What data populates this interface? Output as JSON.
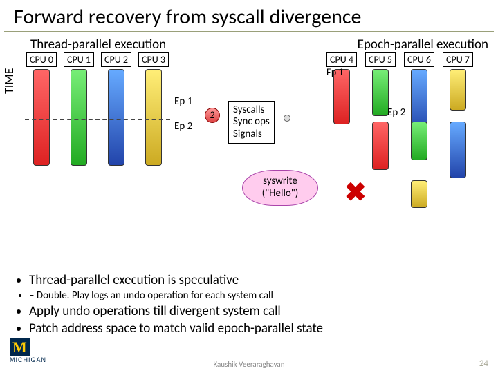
{
  "title": "Forward recovery from syscall divergence",
  "sections": {
    "left": "Thread-parallel execution",
    "right": "Epoch-parallel execution"
  },
  "time_axis": "TIME",
  "cpus": [
    "CPU 0",
    "CPU 1",
    "CPU 2",
    "CPU 3",
    "CPU 4",
    "CPU 5",
    "CPU 6",
    "CPU 7"
  ],
  "ep_labels": {
    "ep1": "Ep 1",
    "ep2": "Ep 2",
    "ep1r": "Ep 1",
    "ep2r": "Ep 2"
  },
  "circle": "2",
  "sigbox": {
    "l1": "Syscalls",
    "l2": "Sync ops",
    "l3": "Signals"
  },
  "cloud": {
    "l1": "syswrite",
    "l2": "(\"Hello\")"
  },
  "bullets": {
    "b1": "Thread-parallel execution is speculative",
    "b1a": "– Double. Play logs an undo operation for each system call",
    "b2": "Apply undo operations till divergent system call",
    "b3": "Patch address space to match valid epoch-parallel state"
  },
  "footer": {
    "name": "Kaushik Veeraraghavan",
    "page": "24"
  },
  "logo": {
    "m": "M",
    "t": "MICHIGAN"
  }
}
